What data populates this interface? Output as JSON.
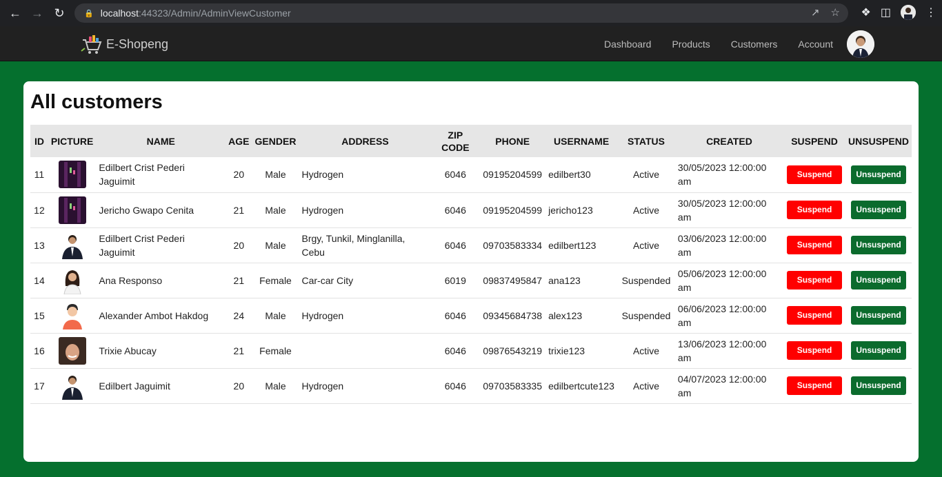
{
  "browser": {
    "url_host": "localhost",
    "url_rest": ":44323/Admin/AdminViewCustomer"
  },
  "navbar": {
    "brand": "E-Shopeng",
    "links": [
      "Dashboard",
      "Products",
      "Customers",
      "Account"
    ]
  },
  "page": {
    "title": "All customers"
  },
  "table": {
    "headers": [
      "ID",
      "PICTURE",
      "NAME",
      "AGE",
      "GENDER",
      "ADDRESS",
      "ZIP CODE",
      "PHONE",
      "USERNAME",
      "STATUS",
      "CREATED",
      "SUSPEND",
      "UNSUSPEND"
    ],
    "rows": [
      {
        "id": "11",
        "picture": "dark-photo",
        "name": "Edilbert Crist Pederi Jaguimit",
        "age": "20",
        "gender": "Male",
        "address": "Hydrogen",
        "zip": "6046",
        "phone": "09195204599",
        "username": "edilbert30",
        "status": "Active",
        "created": "30/05/2023 12:00:00 am"
      },
      {
        "id": "12",
        "picture": "dark-photo",
        "name": "Jericho Gwapo Cenita",
        "age": "21",
        "gender": "Male",
        "address": "Hydrogen",
        "zip": "6046",
        "phone": "09195204599",
        "username": "jericho123",
        "status": "Active",
        "created": "30/05/2023 12:00:00 am"
      },
      {
        "id": "13",
        "picture": "man-suit",
        "name": "Edilbert Crist Pederi Jaguimit",
        "age": "20",
        "gender": "Male",
        "address": "Brgy, Tunkil, Minglanilla, Cebu",
        "zip": "6046",
        "phone": "09703583334",
        "username": "edilbert123",
        "status": "Active",
        "created": "03/06/2023 12:00:00 am"
      },
      {
        "id": "14",
        "picture": "woman",
        "name": "Ana Responso",
        "age": "21",
        "gender": "Female",
        "address": "Car-car City",
        "zip": "6019",
        "phone": "09837495847",
        "username": "ana123",
        "status": "Suspended",
        "created": "05/06/2023 12:00:00 am"
      },
      {
        "id": "15",
        "picture": "cartoon-man",
        "name": "Alexander Ambot Hakdog",
        "age": "24",
        "gender": "Male",
        "address": "Hydrogen",
        "zip": "6046",
        "phone": "09345684738",
        "username": "alex123",
        "status": "Suspended",
        "created": "06/06/2023 12:00:00 am"
      },
      {
        "id": "16",
        "picture": "woman-smile",
        "name": "Trixie Abucay",
        "age": "21",
        "gender": "Female",
        "address": "",
        "zip": "6046",
        "phone": "09876543219",
        "username": "trixie123",
        "status": "Active",
        "created": "13/06/2023 12:00:00 am"
      },
      {
        "id": "17",
        "picture": "man-suit",
        "name": "Edilbert Jaguimit",
        "age": "20",
        "gender": "Male",
        "address": "Hydrogen",
        "zip": "6046",
        "phone": "09703583335",
        "username": "edilbertcute123",
        "status": "Active",
        "created": "04/07/2023 12:00:00 am"
      }
    ],
    "suspend_label": "Suspend",
    "unsuspend_label": "Unsuspend"
  },
  "colors": {
    "background": "#05702e",
    "suspend": "#ff0000",
    "unsuspend": "#0b6b2d",
    "navbar": "#212121"
  }
}
